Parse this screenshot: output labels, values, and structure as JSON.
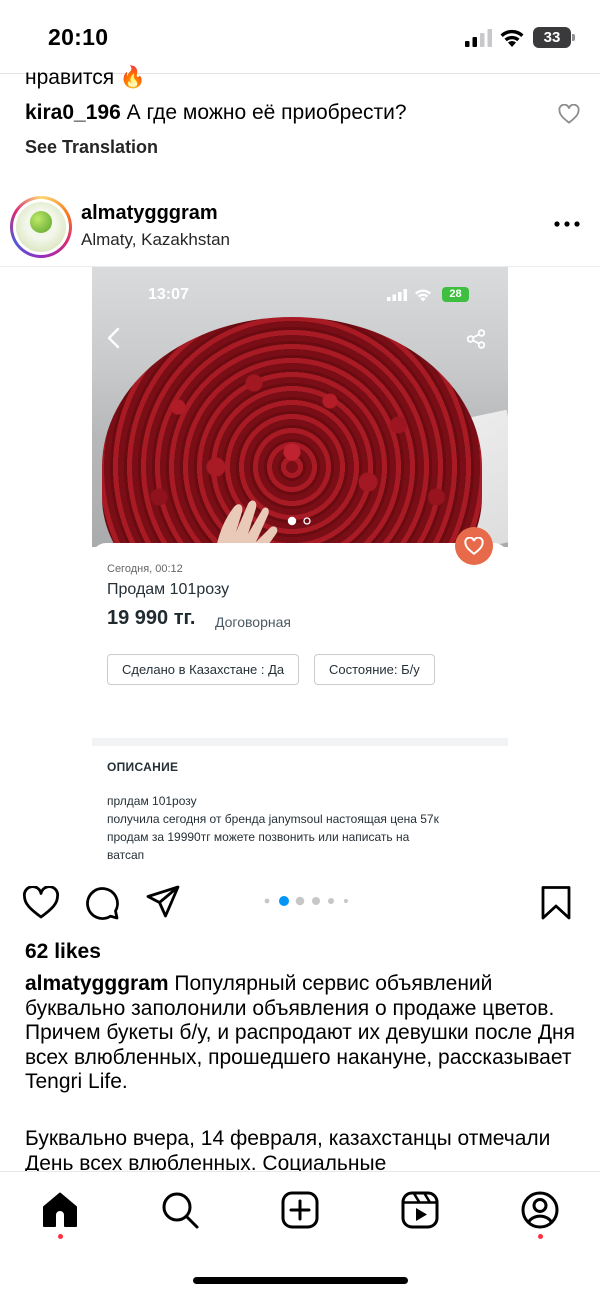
{
  "status_bar": {
    "time": "20:10",
    "battery": "33"
  },
  "previous_comment": {
    "tail_text": "нравится 🔥",
    "user": "kira0_196",
    "text": "А где можно её приобрести?",
    "see_translation": "See Translation"
  },
  "post": {
    "username": "almatygggram",
    "location": "Almaty, Kazakhstan",
    "likes": "62 likes",
    "caption_user": "almatygggram",
    "caption_text": "Популярный сервис объявлений буквально заполонили объявления о продаже цветов. Причем букеты б/у, и распродают их девушки после Дня всех влюбленных, прошедшего накануне, рассказывает Tengri Life.",
    "caption_text_2": "Буквально вчера, 14 февраля, казахстанцы отмечали День всех влюбленных. Социальные",
    "carousel_active_index": 2,
    "carousel_total": 6
  },
  "listing_screenshot": {
    "phone_time": "13:07",
    "phone_battery": "28",
    "date": "Сегодня, 00:12",
    "title": "Продам 101розу",
    "price": "19 990 тг.",
    "negotiable": "Договорная",
    "chip_1": "Сделано в Казахстане : Да",
    "chip_2": "Состояние: Б/у",
    "description_heading": "ОПИСАНИЕ",
    "description_lines": [
      "прлдам 101розу",
      "получила сегодня от бренда janymsoul настоящая цена 57к",
      "продам за 19990тг можете позвонить или написать на",
      "ватсап"
    ]
  },
  "colors": {
    "favorite_button": "#e76a4a",
    "notification_dot": "#ff3040"
  },
  "icons": {
    "like": "heart-icon",
    "comment": "comment-bubble-icon",
    "share": "paper-plane-icon",
    "save": "bookmark-icon",
    "nav": [
      "home-icon",
      "search-icon",
      "create-icon",
      "reels-icon",
      "profile-icon"
    ]
  }
}
